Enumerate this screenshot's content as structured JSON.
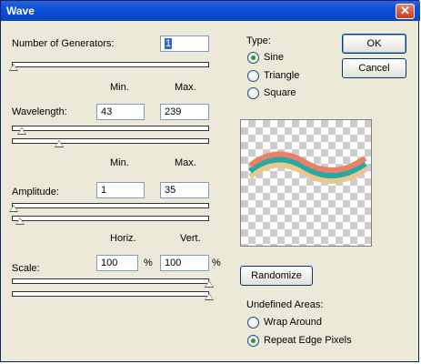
{
  "window": {
    "title": "Wave"
  },
  "generators": {
    "label": "Number of Generators:",
    "value": "1",
    "slider_fraction": 0.0
  },
  "headers1": {
    "min": "Min.",
    "max": "Max."
  },
  "wavelength": {
    "label": "Wavelength:",
    "min": "43",
    "max": "239",
    "min_fraction": 0.04,
    "max_fraction": 0.23
  },
  "headers2": {
    "min": "Min.",
    "max": "Max."
  },
  "amplitude": {
    "label": "Amplitude:",
    "min": "1",
    "max": "35",
    "min_fraction": 0.0,
    "max_fraction": 0.04
  },
  "headers3": {
    "horiz": "Horiz.",
    "vert": "Vert."
  },
  "scale": {
    "label": "Scale:",
    "horiz": "100",
    "vert": "100",
    "unit": "%",
    "horiz_fraction": 1.0,
    "vert_fraction": 1.0
  },
  "type": {
    "label": "Type:",
    "options": [
      {
        "label": "Sine",
        "selected": true
      },
      {
        "label": "Triangle",
        "selected": false
      },
      {
        "label": "Square",
        "selected": false
      }
    ]
  },
  "buttons": {
    "ok": "OK",
    "cancel": "Cancel",
    "randomize": "Randomize"
  },
  "undefined_areas": {
    "label": "Undefined Areas:",
    "options": [
      {
        "label": "Wrap Around",
        "selected": false
      },
      {
        "label": "Repeat Edge Pixels",
        "selected": true
      }
    ]
  },
  "preview": {
    "wave_colors": [
      "#e8806a",
      "#2aa8a4",
      "#e8c890"
    ]
  }
}
